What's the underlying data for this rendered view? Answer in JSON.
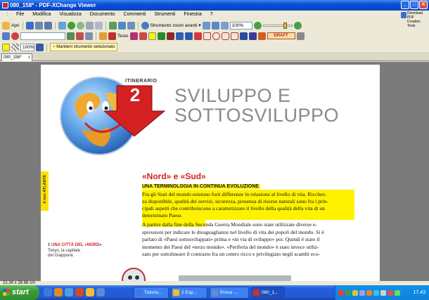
{
  "window": {
    "title": "080_158* - PDF-XChange Viewer",
    "buttons": [
      "_",
      "□",
      "✕"
    ]
  },
  "menu": [
    "File",
    "Modifica",
    "Visualizza",
    "Documento",
    "Commenti",
    "Strumenti",
    "Finestra",
    "?"
  ],
  "download_pdf": {
    "line1": "Download PDF",
    "line2": "Creation Tools"
  },
  "toolbar1": {
    "open": "Apri",
    "zoom_tool": "Strumento zoom avanti",
    "zoom_level": "100%"
  },
  "toolbar2": {
    "text": "Testo",
    "draft": "DRAFT"
  },
  "toolbar3": {
    "zoom": "100%",
    "hint": "Mantieni strumento selezionato"
  },
  "tab": {
    "name": "080_158*",
    "close": "x"
  },
  "page": {
    "itinerario": "ITINERARIO",
    "number": "2",
    "title1": "SVILUPPO E",
    "title2": "SOTTOSVILUPPO",
    "side_tab1": "Il mio",
    "side_tab2": "ATLANTE",
    "section_title": "«Nord» e «Sud»",
    "subtitle": "UNA TERMINOLOGIA IN CONTINUA EVOLUZIONE",
    "highlight_lines": [
      "Fra gli Stati del mondo esistono forti differenze in relazione al livello di vita. Ricchez-",
      "za disponibile, qualità dei servizi, sicurezza, presenza di risorse naturali sono fra i prin-",
      "cipali aspetti che contribuiscono a caratterizzare il livello della qualità della vita di un",
      "determinato Paese."
    ],
    "body_lines": [
      "A partire dalla fine della Seconda Guerra Mondiale sono state utilizzate diverse e-",
      "spressioni per indicare le disuguaglianze nel livello di vita dei popoli del mondo. Si è",
      "parlato di «Paesi sottosviluppati» prima e «in via di sviluppo» poi. Quindi è stato il",
      "momento dei Paesi del «terzo mondo». «Periferia del mondo» è stato invece utiliz-",
      "zato per sottolineare il contrasto fra un centro ricco e privilegiato negli scambi eco-"
    ],
    "caption_num": "1",
    "caption_head": "UNA CITTÀ DEL «NORD»",
    "caption_line1": "Tokyo, la capitale",
    "caption_line2": "del Giappone."
  },
  "status": "21.34 x 28.68 cm",
  "taskbar": {
    "start": "start",
    "tasks": [
      "Tutoria...",
      "2 Esp...",
      "Prova -...",
      "080_1..."
    ],
    "clock": "17.43"
  },
  "colors": {
    "accent_red": "#d42020",
    "title_gray": "#8a8a8a",
    "highlight": "#fff200",
    "side_tab": "#ffe200"
  }
}
